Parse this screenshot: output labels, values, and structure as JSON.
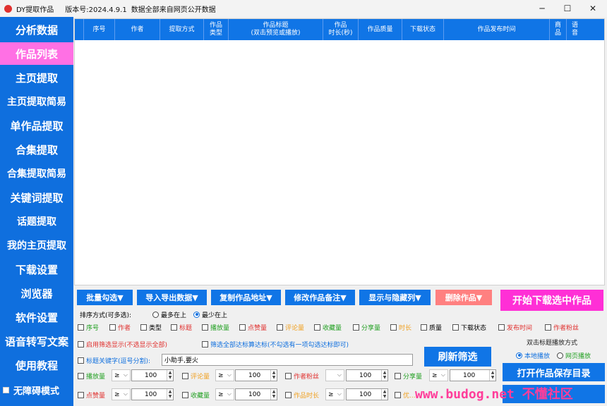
{
  "titlebar": {
    "app_name": "DY提取作品",
    "version": "版本号:2024.4.9.1",
    "notice": "数据全部来自网页公开数据",
    "minimize": "─",
    "maximize": "☐",
    "close": "✕"
  },
  "sidebar": {
    "items": [
      "分析数据",
      "作品列表",
      "主页提取",
      "主页提取简易",
      "单作品提取",
      "合集提取",
      "合集提取简易",
      "关键词提取",
      "话题提取",
      "我的主页提取",
      "下载设置",
      "浏览器",
      "软件设置",
      "语音转写文案",
      "使用教程"
    ],
    "accessibility": "无障碍模式"
  },
  "grid": {
    "columns": [
      "",
      "序号",
      "作者",
      "提取方式",
      "作品\n类型",
      "作品标题\n(双击预览或播放)",
      "作品\n时长(秒)",
      "作品质量",
      "下载状态",
      "作品发布时间",
      "商\n品",
      "语\n音"
    ]
  },
  "toolbar": {
    "batch_select": "批量勾选▼",
    "import_export": "导入导出数据▼",
    "copy_url": "复制作品地址▼",
    "edit_note": "修改作品备注▼",
    "show_hide_cols": "显示与隐藏列▼",
    "delete": "删除作品▼",
    "start_download": "开始下载选中作品"
  },
  "sort": {
    "label": "排序方式(可多选):",
    "most_top": "最多在上",
    "least_top": "最少在上"
  },
  "sort_fields": [
    "序号",
    "作者",
    "类型",
    "标题",
    "播放量",
    "点赞量",
    "评论量",
    "收藏量",
    "分享量",
    "时长",
    "质量",
    "下载状态",
    "发布时间",
    "作者粉丝"
  ],
  "filter": {
    "enable": "启用筛选显示(不选显示全部)",
    "all_meet": "筛选全部达标算达标(不勾选有一项勾选达标即可)",
    "kw_label": "标题关键字(逗号分割):",
    "kw_value": "小助手,要火",
    "refresh": "刷新筛选",
    "ge": "≥"
  },
  "filter_rows": [
    [
      {
        "name": "播放量",
        "value": "100"
      },
      {
        "name": "评论量",
        "value": "100"
      },
      {
        "name": "作者粉丝",
        "value": "100"
      },
      {
        "name": "分享量",
        "value": "100"
      }
    ],
    [
      {
        "name": "点赞量",
        "value": "100"
      },
      {
        "name": "收藏量",
        "value": "100"
      },
      {
        "name": "作品时长",
        "value": "100"
      },
      {
        "name": "优...",
        "value": ""
      }
    ]
  ],
  "play": {
    "title": "双击标题播放方式",
    "local": "本地播放",
    "web": "网页播放"
  },
  "open_dir": "打开作品保存目录",
  "watermark": "www.budog.net 不懂社区",
  "colors": {
    "accent": "#0f6fde",
    "selected": "#ff70e4",
    "delete": "#ff8080",
    "start": "#ff2fd6",
    "green": "#22a022",
    "red": "#e0312f",
    "orange": "#f0a020"
  }
}
